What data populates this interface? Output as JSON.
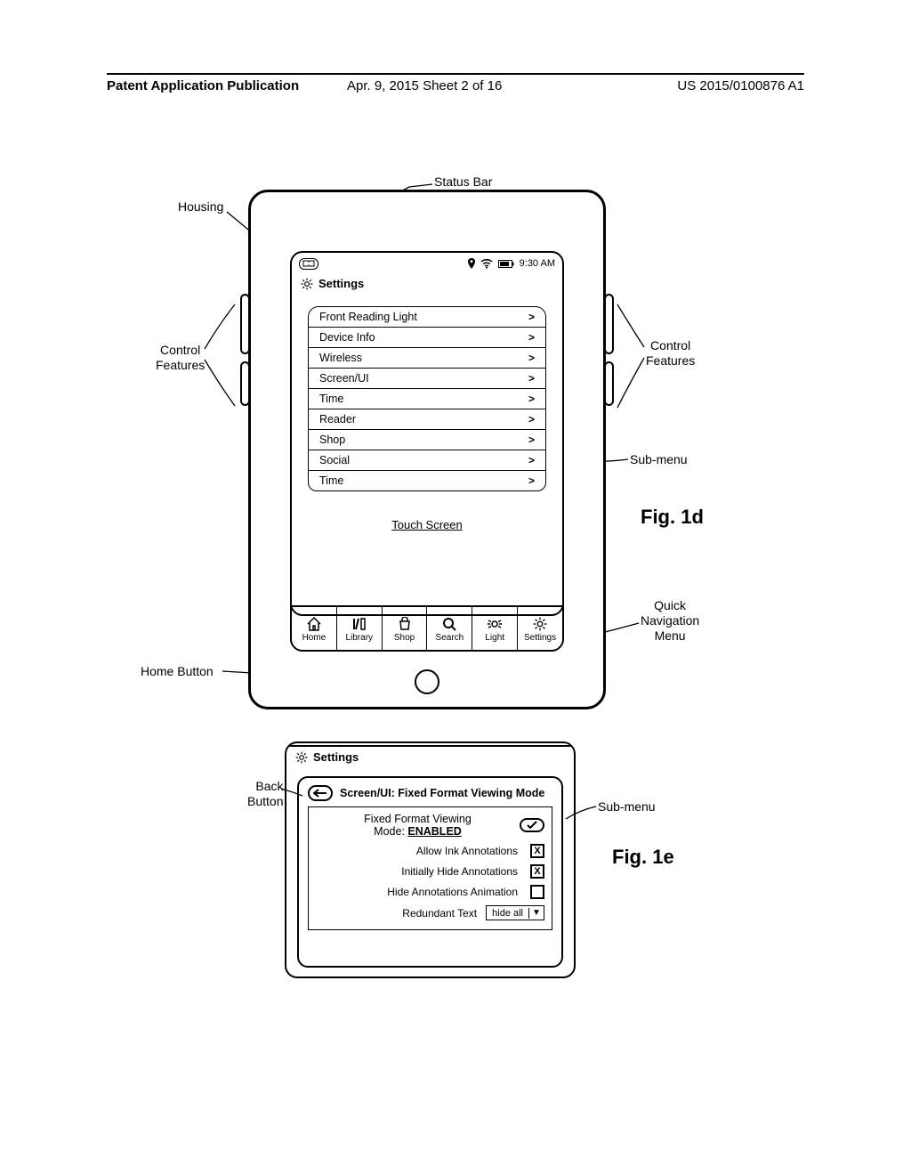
{
  "page_header": {
    "left": "Patent Application Publication",
    "center": "Apr. 9, 2015  Sheet 2 of 16",
    "right": "US 2015/0100876 A1"
  },
  "fig1d": {
    "label": "Fig. 1d",
    "callouts": {
      "housing": "Housing",
      "statusbar": "Status Bar",
      "control_left": "Control\nFeatures",
      "control_right": "Control\nFeatures",
      "submenu": "Sub-menu",
      "quicknav": "Quick\nNavigation\nMenu",
      "homebutton": "Home Button"
    },
    "statusbar": {
      "time": "9:30 AM"
    },
    "settings_title": "Settings",
    "submenu_items": [
      "Front Reading Light",
      "Device Info",
      "Wireless",
      "Screen/UI",
      "Time",
      "Reader",
      "Shop",
      "Social",
      "Time"
    ],
    "touchscreen_label": "Touch Screen",
    "quicknav": [
      "Home",
      "Library",
      "Shop",
      "Search",
      "Light",
      "Settings"
    ]
  },
  "fig1e": {
    "label": "Fig. 1e",
    "callouts": {
      "back": "Back\nButton",
      "submenu": "Sub-menu"
    },
    "settings_title": "Settings",
    "header": "Screen/UI: Fixed Format Viewing Mode",
    "enabled": {
      "line1": "Fixed Format Viewing",
      "line2_prefix": "Mode: ",
      "line2_value": "ENABLED"
    },
    "rows": {
      "allow_ink": "Allow Ink Annotations",
      "hide_init": "Initially Hide Annotations",
      "hide_anim": "Hide Annotations Animation",
      "redundant": "Redundant Text"
    },
    "checks": {
      "allow_ink": true,
      "hide_init": true,
      "hide_anim": false
    },
    "dropdown_value": "hide all"
  }
}
